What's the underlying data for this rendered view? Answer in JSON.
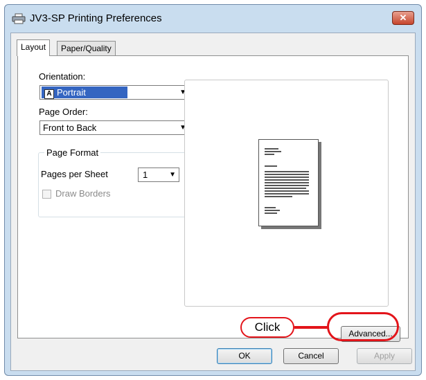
{
  "window": {
    "title": "JV3-SP Printing Preferences",
    "close_label": "✕"
  },
  "tabs": [
    {
      "label": "Layout"
    },
    {
      "label": "Paper/Quality"
    }
  ],
  "layout": {
    "orientation_label": "Orientation:",
    "orientation_value": "Portrait",
    "page_order_label": "Page Order:",
    "page_order_value": "Front to Back",
    "page_format_title": "Page Format",
    "pages_per_sheet_label": "Pages per Sheet",
    "pages_per_sheet_value": "1",
    "draw_borders_label": "Draw Borders"
  },
  "buttons": {
    "advanced": "Advanced...",
    "ok": "OK",
    "cancel": "Cancel",
    "apply": "Apply"
  },
  "callout": {
    "text": "Click"
  },
  "colors": {
    "accent_selection": "#3465c1",
    "callout_red": "#e3141a",
    "title_bg": "#c9ddef"
  }
}
